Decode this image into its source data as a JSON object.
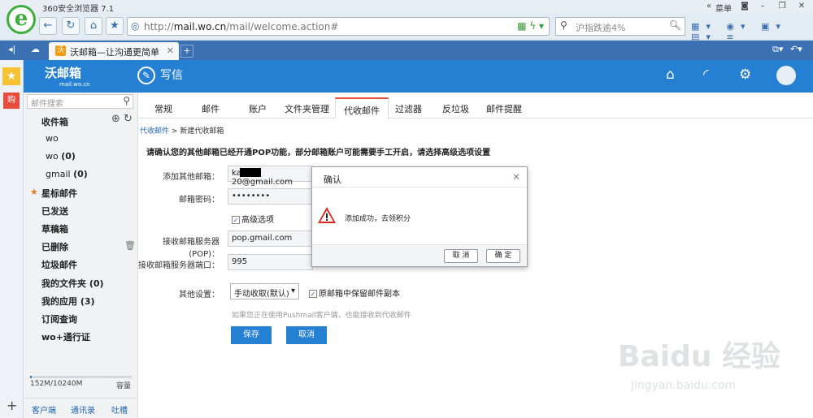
{
  "browser": {
    "app_title": "360安全浏览器 7.1",
    "menu_label": "菜单",
    "url_prefix": "http://",
    "url_domain": "mail.wo.cn",
    "url_path": "/mail/welcome.action#",
    "search_placeholder": "沪指跌逾4%",
    "tab_title": "沃邮箱—让沟通更简单"
  },
  "header": {
    "logo_text": "沃邮箱",
    "logo_sub": "mail.wo.cn",
    "compose_label": "写信"
  },
  "sidebar": {
    "search_placeholder": "邮件搜索",
    "inbox": "收件箱",
    "accounts": [
      {
        "name": "wo",
        "count": ""
      },
      {
        "name": "wo",
        "count": "(0)"
      },
      {
        "name": "gmail",
        "count": "(0)"
      }
    ],
    "starred": "星标邮件",
    "sent": "已发送",
    "drafts": "草稿箱",
    "deleted": "已删除",
    "junk": "垃圾邮件",
    "my_folders": "我的文件夹 (0)",
    "my_apps": "我的应用 (3)",
    "subscriptions": "订阅查询",
    "wo_pass": "wo+通行证",
    "storage_text": "152M/10240M",
    "storage_label": "容量",
    "storage_fraction": 0.015,
    "links": [
      "客户端",
      "通讯录",
      "吐槽"
    ]
  },
  "tabs": [
    "常规",
    "邮件",
    "账户",
    "文件夹管理",
    "代收邮件",
    "过滤器",
    "反垃圾",
    "邮件提醒"
  ],
  "breadcrumb": {
    "parent": "代收邮件",
    "sep": ">",
    "current": "新建代收邮箱"
  },
  "form": {
    "notice": "请确认您的其他邮箱已经开通POP功能，部分邮箱账户可能需要手工开启，请选择高级选项设置",
    "email_label": "添加其他邮箱：",
    "email_prefix": "ka",
    "email_suffix": "20@gmail.com",
    "password_label": "邮箱密码：",
    "password_value": "••••••••",
    "advanced_label": "高级选项",
    "pop_label": "接收邮箱服务器(POP)：",
    "pop_value": "pop.gmail.com",
    "port_label": "接收邮箱服务器端口：",
    "port_value": "995",
    "other_label": "其他设置：",
    "mode_value": "手动收取(默认)",
    "keep_copy_label": "原邮箱中保留邮件副本",
    "hint": "如果您正在使用Pushmail客户端，也能接收到代收邮件",
    "save": "保存",
    "cancel": "取消"
  },
  "dialog": {
    "title": "确认",
    "message": "添加成功，去领积分",
    "cancel": "取 消",
    "ok": "确 定"
  },
  "watermark": {
    "text": "Baidu 经验",
    "url": "jingyan.baidu.com"
  }
}
